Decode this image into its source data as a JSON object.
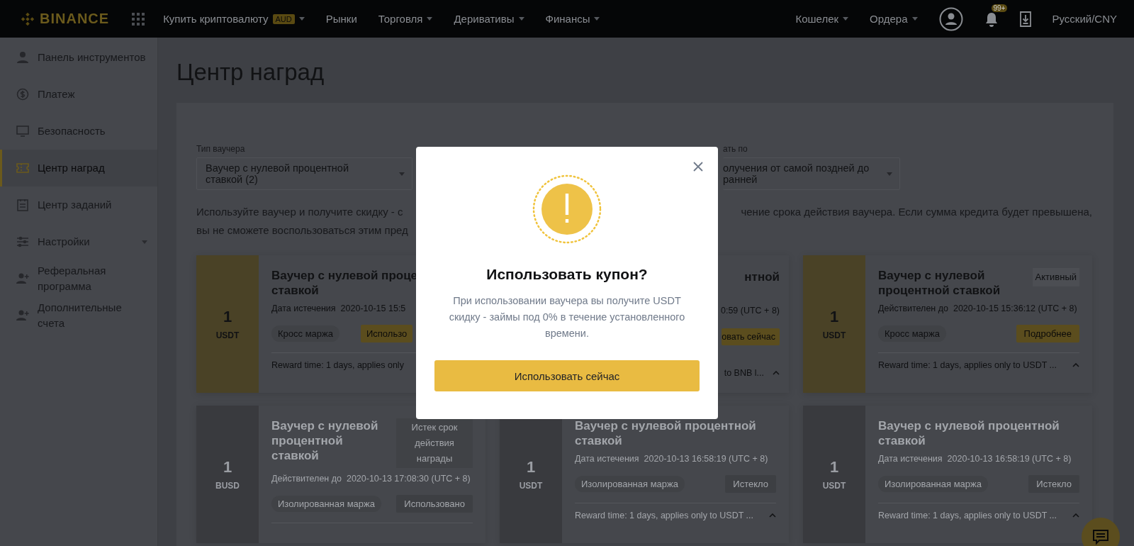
{
  "header": {
    "logo": "BINANCE",
    "nav": [
      {
        "label": "Купить криптовалюту",
        "badge": "AUD",
        "caret": true
      },
      {
        "label": "Рынки",
        "caret": false
      },
      {
        "label": "Торговля",
        "caret": true
      },
      {
        "label": "Деривативы",
        "caret": true
      },
      {
        "label": "Финансы",
        "caret": true
      }
    ],
    "right_nav": [
      {
        "label": "Кошелек",
        "caret": true
      },
      {
        "label": "Ордера",
        "caret": true
      }
    ],
    "notifications_badge": "99+",
    "language": "Русский/CNY"
  },
  "sidebar": {
    "items": [
      {
        "label": "Панель инструментов",
        "selected": false,
        "caret": false
      },
      {
        "label": "Платеж",
        "selected": false,
        "caret": false
      },
      {
        "label": "Безопасность",
        "selected": false,
        "caret": false
      },
      {
        "label": "Центр наград",
        "selected": true,
        "caret": false
      },
      {
        "label": "Центр заданий",
        "selected": false,
        "caret": false
      },
      {
        "label": "Настройки",
        "selected": false,
        "caret": true
      },
      {
        "label": "Реферальная программа",
        "selected": false,
        "caret": false
      },
      {
        "label": "Дополнительные счета",
        "selected": false,
        "caret": false
      }
    ]
  },
  "page_title": "Центр наград",
  "filters": [
    {
      "label": "Тип ваучера",
      "value": "Ваучер с нулевой процентной\nставкой (2)"
    },
    {
      "label": "ать по",
      "value": "олучения от самой поздней до\nранней"
    }
  ],
  "notice": {
    "left": "Используйте ваучер и получите скидку - с\nвы не сможете воспользоваться этим пред",
    "right": "чение срока действия ваучера. Если сумма кредита будет превышена,"
  },
  "cards": [
    {
      "kind": "cut",
      "expired": false,
      "amount": "1",
      "currency": "USDT",
      "title": "Ваучер с нулевой проце\nставкой",
      "date_label": "Дата истечения",
      "date": "2020-10-15 15:5",
      "tag": "Кросс маржа",
      "button": "Использо",
      "reward": "Reward time: 1 days, applies only"
    },
    {
      "kind": "covered",
      "expired": false,
      "title": "нтной",
      "date": "0:59 (UTC + 8)",
      "button": "овать сейчас",
      "reward": "to BNB l..."
    },
    {
      "kind": "full",
      "expired": false,
      "amount": "1",
      "currency": "USDT",
      "badge": "Активный",
      "title": "Ваучер с нулевой\nпроцентной ставкой",
      "date_label": "Действителен до",
      "date": "2020-10-15 15:36:12 (UTC + 8)",
      "tag": "Кросс маржа",
      "button": "Подробнее",
      "reward": "Reward time: 1 days, applies only to USDT ..."
    },
    {
      "kind": "full",
      "expired": true,
      "amount": "1",
      "currency": "BUSD",
      "badge": "Истек срок действия награды",
      "title": "Ваучер с нулевой\nпроцентной\nставкой",
      "date_label": "Действителен до",
      "date": "2020-10-13 17:08:30 (UTC + 8)",
      "tag": "Изолированная маржа",
      "button": "Использовано"
    },
    {
      "kind": "full",
      "expired": true,
      "amount": "1",
      "currency": "USDT",
      "title": "Ваучер с нулевой процентной\nставкой",
      "date_label": "Дата истечения",
      "date": "2020-10-13 16:58:19 (UTC + 8)",
      "tag": "Изолированная маржа",
      "button": "Истекло",
      "reward": "Reward time: 1 days, applies only to USDT ..."
    },
    {
      "kind": "full",
      "expired": true,
      "amount": "1",
      "currency": "USDT",
      "title": "Ваучер с нулевой процентной\nставкой",
      "date_label": "Дата истечения",
      "date": "2020-10-13 16:58:19 (UTC + 8)",
      "tag": "Изолированная маржа",
      "button": "Истекло",
      "reward": "Reward time: 1 days, applies only to USDT ..."
    }
  ],
  "modal": {
    "title": "Использовать купон?",
    "text": "При использовании ваучера вы получите USDT скидку - займы под 0% в течение установленного времени.",
    "button": "Использовать сейчас"
  }
}
